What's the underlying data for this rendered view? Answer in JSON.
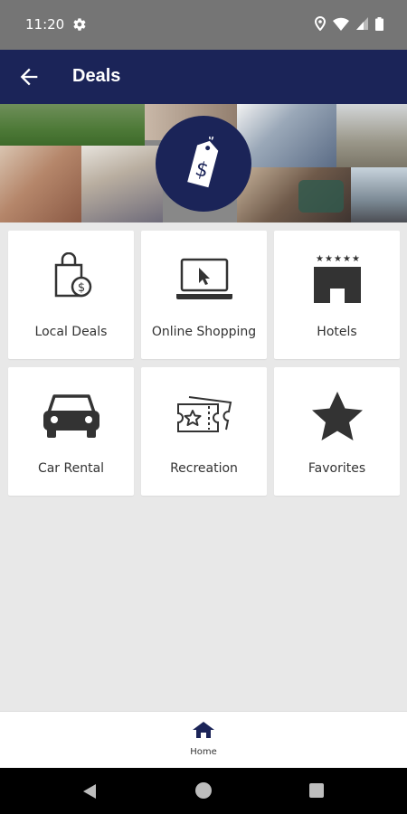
{
  "status_bar": {
    "time": "11:20",
    "icons": [
      "gear-icon",
      "location-icon",
      "wifi-icon",
      "signal-icon",
      "battery-icon"
    ]
  },
  "app_bar": {
    "title": "Deals",
    "back_icon": "arrow-left-icon"
  },
  "hero": {
    "badge_icon": "price-tag-dollar-icon"
  },
  "categories": [
    {
      "label": "Local Deals",
      "icon": "shopping-bag-dollar-icon"
    },
    {
      "label": "Online Shopping",
      "icon": "laptop-cursor-icon"
    },
    {
      "label": "Hotels",
      "icon": "hotel-stars-icon"
    },
    {
      "label": "Car Rental",
      "icon": "car-icon"
    },
    {
      "label": "Recreation",
      "icon": "ticket-star-icon"
    },
    {
      "label": "Favorites",
      "icon": "star-icon"
    }
  ],
  "bottom_nav": {
    "home_label": "Home",
    "home_icon": "home-icon"
  },
  "colors": {
    "primary": "#1b2458",
    "status_bar": "#757575",
    "background": "#e8e8e8",
    "icon": "#333333"
  }
}
